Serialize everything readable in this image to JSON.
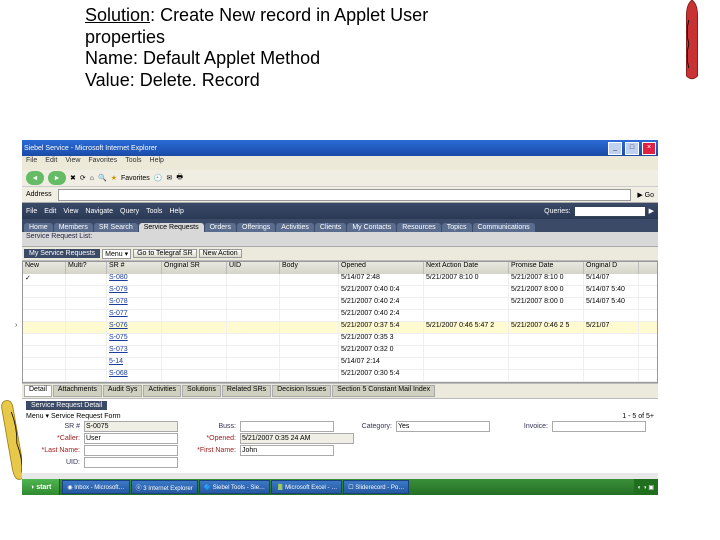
{
  "slide": {
    "sol_label": "Solution",
    "sol_line1": ": Create New record in Applet User",
    "sol_line2": "properties",
    "sol_line3": "Name: Default Applet Method",
    "sol_line4": "Value: Delete. Record"
  },
  "window": {
    "title": "Siebel Service - Microsoft Internet Explorer",
    "menus": [
      "File",
      "Edit",
      "View",
      "Favorites",
      "Tools",
      "Help"
    ],
    "fav_label": "Favorites",
    "btn_min": "_",
    "btn_max": "□",
    "btn_close": "×"
  },
  "app": {
    "menus": [
      "File",
      "Edit",
      "View",
      "Navigate",
      "Query",
      "Tools",
      "Help"
    ],
    "queries_label": "Queries:",
    "nav_tabs": [
      "Home",
      "Members",
      "SR Search",
      "Service Requests",
      "Orders",
      "Offerings",
      "Activities",
      "Clients",
      "My Contacts",
      "Resources",
      "Topics",
      "Communications"
    ],
    "view_label": "Service Request List:"
  },
  "applet": {
    "title": "My Service Requests",
    "menu_label": "Menu ▾",
    "help_label": "Go to Telegraf SR",
    "new_label": "New Action",
    "cols": [
      "New",
      "Multi?",
      "SR #",
      "Original SR",
      "UID",
      "Body",
      "Opened",
      "Next Action Date",
      "Promise Date",
      "Original D"
    ],
    "rows": [
      {
        "new": "✓",
        "sr": "S-080",
        "opened": "5/14/07 2:48",
        "next": "5/21/2007 8:10 0",
        "prom": "5/21/2007 8:10 0",
        "od": "5/14/07"
      },
      {
        "sr": "S-079",
        "opened": "5/21/2007 0:40 0:4",
        "next": "",
        "prom": "5/21/2007 8:00 0",
        "od": "5/14/07 5:40"
      },
      {
        "sr": "S-078",
        "opened": "5/21/2007 0:40 2:4",
        "next": "",
        "prom": "5/21/2007 8:00 0",
        "od": "5/14/07 5:40"
      },
      {
        "sr": "S-077",
        "opened": "5/21/2007 0:40 2:4",
        "next": "",
        "prom": "",
        "od": ""
      },
      {
        "sel": true,
        "sr": "S-076",
        "opened": "5/21/2007 0:37 5:4",
        "next": "5/21/2007 0:46 5:47 2",
        "prom": "5/21/2007 0:46 2 5",
        "od": "5/21/07"
      },
      {
        "sr": "S-075",
        "opened": "5/21/2007 0:35 3",
        "next": "",
        "prom": "",
        "od": ""
      },
      {
        "sr": "S-073",
        "opened": "5/21/2007 0:32 0",
        "next": "",
        "prom": "",
        "od": ""
      },
      {
        "sr": "5-14",
        "opened": "5/14/07 2:14",
        "next": "",
        "prom": "",
        "od": ""
      },
      {
        "sr": "S-068",
        "opened": "5/21/2007 0:30 5:4",
        "next": "",
        "prom": "",
        "od": ""
      }
    ]
  },
  "lowtabs": [
    "Detail",
    "Attachments",
    "Audit Sys",
    "Activities",
    "Solutions",
    "Related SRs",
    "Decision Issues",
    "Section 5 Constant Mail Index"
  ],
  "detail": {
    "title": "Service Request Detail",
    "menu_label": "Menu ▾",
    "applet_label": "Service Request Form",
    "page": "1 - 5 of 5+",
    "fields": {
      "sr_l": "SR #",
      "sr_v": "S-0075",
      "buss_l": "Buss:",
      "buss_v": "",
      "cat_l": "Category:",
      "cat_v": "Yes",
      "inv_l": "Invoice:",
      "inv_v": "",
      "caller_l": "*Caller:",
      "caller_v": "User",
      "opened_l": "*Opened:",
      "opened_v": "5/21/2007 0:35 24 AM",
      "last_l": "*Last Name:",
      "last_v": "",
      "first_l": "*First Name:",
      "first_v": "John",
      "uid_l": "UID:",
      "uid_v": ""
    }
  },
  "taskbar": {
    "start": "start",
    "tasks": [
      "◉ Inbox - Microsoft…",
      "ⓔ 3 Internet Explorer",
      "🔷 Siebel Tools - Sie…",
      "📗 Microsoft Excel - …",
      "☐ Sliderecord - Po…"
    ]
  }
}
